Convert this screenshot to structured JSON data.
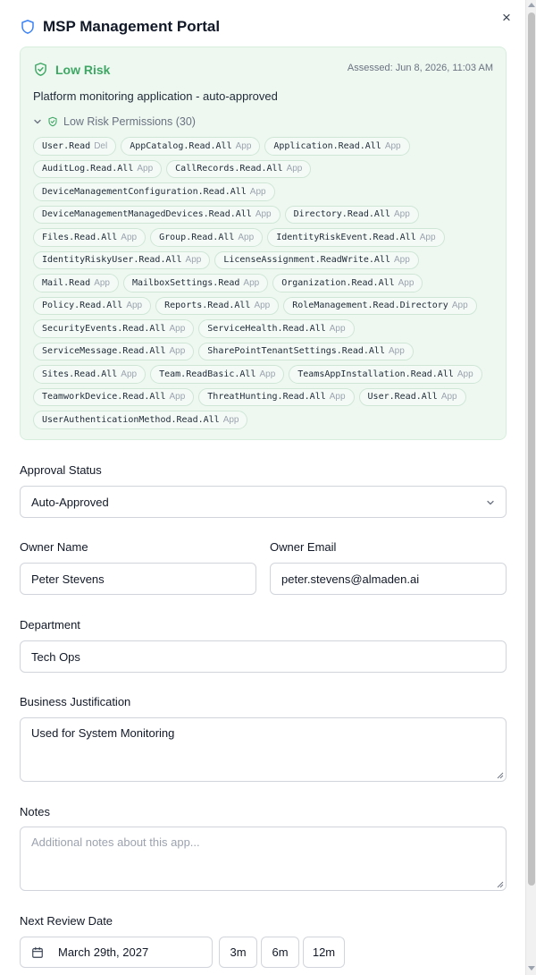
{
  "header": {
    "title": "MSP Management Portal",
    "close_label": "×"
  },
  "risk": {
    "level": "Low Risk",
    "assessed": "Assessed: Jun 8, 2026, 11:03 AM",
    "description": "Platform monitoring application - auto-approved",
    "permissions_label": "Low Risk Permissions (30)",
    "colors": {
      "accent": "#3fa764",
      "background": "#eef8f1"
    },
    "permissions": [
      {
        "name": "User.Read",
        "type": "Del"
      },
      {
        "name": "AppCatalog.Read.All",
        "type": "App"
      },
      {
        "name": "Application.Read.All",
        "type": "App"
      },
      {
        "name": "AuditLog.Read.All",
        "type": "App"
      },
      {
        "name": "CallRecords.Read.All",
        "type": "App"
      },
      {
        "name": "DeviceManagementConfiguration.Read.All",
        "type": "App"
      },
      {
        "name": "DeviceManagementManagedDevices.Read.All",
        "type": "App"
      },
      {
        "name": "Directory.Read.All",
        "type": "App"
      },
      {
        "name": "Files.Read.All",
        "type": "App"
      },
      {
        "name": "Group.Read.All",
        "type": "App"
      },
      {
        "name": "IdentityRiskEvent.Read.All",
        "type": "App"
      },
      {
        "name": "IdentityRiskyUser.Read.All",
        "type": "App"
      },
      {
        "name": "LicenseAssignment.ReadWrite.All",
        "type": "App"
      },
      {
        "name": "Mail.Read",
        "type": "App"
      },
      {
        "name": "MailboxSettings.Read",
        "type": "App"
      },
      {
        "name": "Organization.Read.All",
        "type": "App"
      },
      {
        "name": "Policy.Read.All",
        "type": "App"
      },
      {
        "name": "Reports.Read.All",
        "type": "App"
      },
      {
        "name": "RoleManagement.Read.Directory",
        "type": "App"
      },
      {
        "name": "SecurityEvents.Read.All",
        "type": "App"
      },
      {
        "name": "ServiceHealth.Read.All",
        "type": "App"
      },
      {
        "name": "ServiceMessage.Read.All",
        "type": "App"
      },
      {
        "name": "SharePointTenantSettings.Read.All",
        "type": "App"
      },
      {
        "name": "Sites.Read.All",
        "type": "App"
      },
      {
        "name": "Team.ReadBasic.All",
        "type": "App"
      },
      {
        "name": "TeamsAppInstallation.Read.All",
        "type": "App"
      },
      {
        "name": "TeamworkDevice.Read.All",
        "type": "App"
      },
      {
        "name": "ThreatHunting.Read.All",
        "type": "App"
      },
      {
        "name": "User.Read.All",
        "type": "App"
      },
      {
        "name": "UserAuthenticationMethod.Read.All",
        "type": "App"
      }
    ]
  },
  "form": {
    "approval_status": {
      "label": "Approval Status",
      "value": "Auto-Approved"
    },
    "owner_name": {
      "label": "Owner Name",
      "value": "Peter Stevens"
    },
    "owner_email": {
      "label": "Owner Email",
      "value": "peter.stevens@almaden.ai"
    },
    "department": {
      "label": "Department",
      "value": "Tech Ops"
    },
    "justification": {
      "label": "Business Justification",
      "value": "Used for System Monitoring"
    },
    "notes": {
      "label": "Notes",
      "placeholder": "Additional notes about this app..."
    },
    "next_review": {
      "label": "Next Review Date",
      "date": "March 29th, 2027",
      "quick_3m": "3m",
      "quick_6m": "6m",
      "quick_12m": "12m"
    }
  },
  "icons": {
    "header": "shield-icon",
    "risk": "shield-check-icon",
    "toggle": "chevron-down-icon",
    "date": "calendar-icon"
  }
}
